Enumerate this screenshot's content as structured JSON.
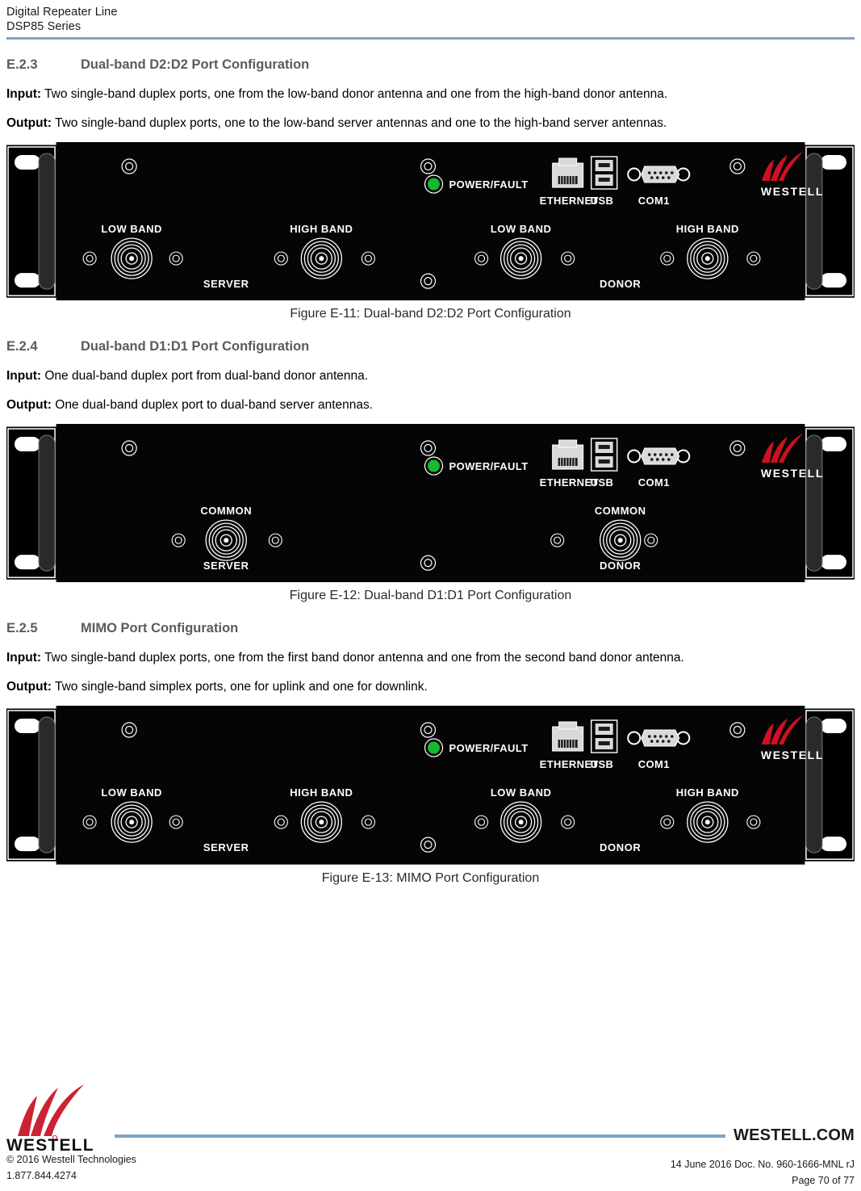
{
  "header": {
    "line1": "Digital Repeater Line",
    "line2": "DSP85 Series",
    "rule_color": "#7ea2c4"
  },
  "sections": [
    {
      "number": "E.2.3",
      "title": "Dual-band D2:D2 Port Configuration",
      "input_label": "Input:",
      "input_text": " Two single-band duplex ports, one from the low-band donor antenna and one from the high-band donor antenna.",
      "output_label": "Output:",
      "output_text": " Two single-band duplex ports, one to the low-band server antennas and one to the high-band server antennas.",
      "figure_caption": "Figure E-11: Dual-band D2:D2 Port Configuration",
      "panel": {
        "server_label": "SERVER",
        "donor_label": "DONOR",
        "server_ports": [
          "LOW BAND",
          "HIGH BAND"
        ],
        "donor_ports": [
          "LOW BAND",
          "HIGH BAND"
        ],
        "led_label": "POWER/FAULT",
        "led_color": "#18b830",
        "ethernet_label": "ETHERNET",
        "usb_label": "USB",
        "com_label": "COM1",
        "brand": "WESTELL",
        "brand_mark_color": "#cc1122"
      }
    },
    {
      "number": "E.2.4",
      "title": "Dual-band D1:D1 Port Configuration",
      "input_label": "Input:",
      "input_text": " One dual-band duplex port from dual-band donor antenna.",
      "output_label": "Output:",
      "output_text": " One dual-band duplex port to dual-band server antennas.",
      "figure_caption": "Figure E-12: Dual-band D1:D1 Port Configuration",
      "panel": {
        "server_label": "SERVER",
        "donor_label": "DONOR",
        "server_ports": [
          "COMMON"
        ],
        "donor_ports": [
          "COMMON"
        ],
        "led_label": "POWER/FAULT",
        "led_color": "#18b830",
        "ethernet_label": "ETHERNET",
        "usb_label": "USB",
        "com_label": "COM1",
        "brand": "WESTELL",
        "brand_mark_color": "#cc1122"
      }
    },
    {
      "number": "E.2.5",
      "title": "MIMO Port Configuration",
      "input_label": "Input:",
      "input_text": " Two single-band duplex ports, one from the first band donor antenna and one from the second band donor antenna.",
      "output_label": "Output:",
      "output_text": " Two single-band simplex ports, one for uplink and one for downlink.",
      "figure_caption": "Figure E-13: MIMO Port Configuration",
      "panel": {
        "server_label": "SERVER",
        "donor_label": "DONOR",
        "server_ports": [
          "LOW BAND",
          "HIGH BAND"
        ],
        "donor_ports": [
          "LOW BAND",
          "HIGH BAND"
        ],
        "led_label": "POWER/FAULT",
        "led_color": "#18b830",
        "ethernet_label": "ETHERNET",
        "usb_label": "USB",
        "com_label": "COM1",
        "brand": "WESTELL",
        "brand_mark_color": "#cc1122"
      }
    }
  ],
  "footer": {
    "brand": "WESTELL",
    "dotcom": "WESTELL.COM",
    "copyright": "© 2016 Westell Technologies",
    "phone": "1.877.844.4274",
    "doc_info": "14 June 2016 Doc. No. 960-1666-MNL rJ",
    "page_info": "Page 70 of 77",
    "rule_color": "#7ea2c4",
    "mark_color": "#cc2233"
  }
}
